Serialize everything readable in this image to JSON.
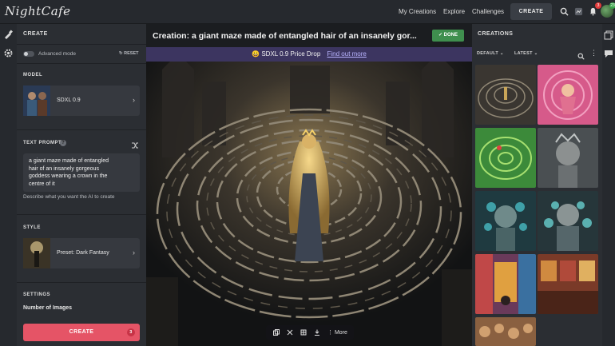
{
  "app": {
    "logo_text": "NightCafe"
  },
  "topnav": {
    "links": [
      "My Creations",
      "Explore",
      "Challenges"
    ],
    "create_label": "CREATE",
    "notif_badge": "3",
    "avatar_badge": "23",
    "icons": [
      "search-icon",
      "gallery-icon",
      "bell-icon",
      "avatar"
    ]
  },
  "left": {
    "header": "CREATE",
    "advanced_mode": "Advanced mode",
    "reset": "RESET",
    "model_title": "MODEL",
    "model_name": "SDXL 0.9",
    "prompt_title": "TEXT PROMPT",
    "prompt_text": "a giant maze made of entangled\nhair of an insanely gorgeous\ngoddess wearing a crown in the\ncentre of it",
    "prompt_hint": "Describe what you want the AI to create",
    "style_title": "STYLE",
    "style_name": "Preset: Dark Fantasy",
    "settings_title": "SETTINGS",
    "num_images_label": "Number of Images",
    "create_button": "CREATE",
    "create_count": "3"
  },
  "center": {
    "title": "Creation: a giant maze made of entangled hair of an insanely gor...",
    "done_label": "DONE",
    "promo_emoji": "😀",
    "promo_text": "SDXL 0.9 Price Drop",
    "promo_link": "Find out more",
    "toolbar_more": "More"
  },
  "right": {
    "header": "CREATIONS",
    "filter_sort": "DEFAULT",
    "filter_time": "LATEST"
  },
  "colors": {
    "accent_create": "#e55466",
    "done_green": "#3f8f4e",
    "promo_bg": "#3c3560"
  }
}
